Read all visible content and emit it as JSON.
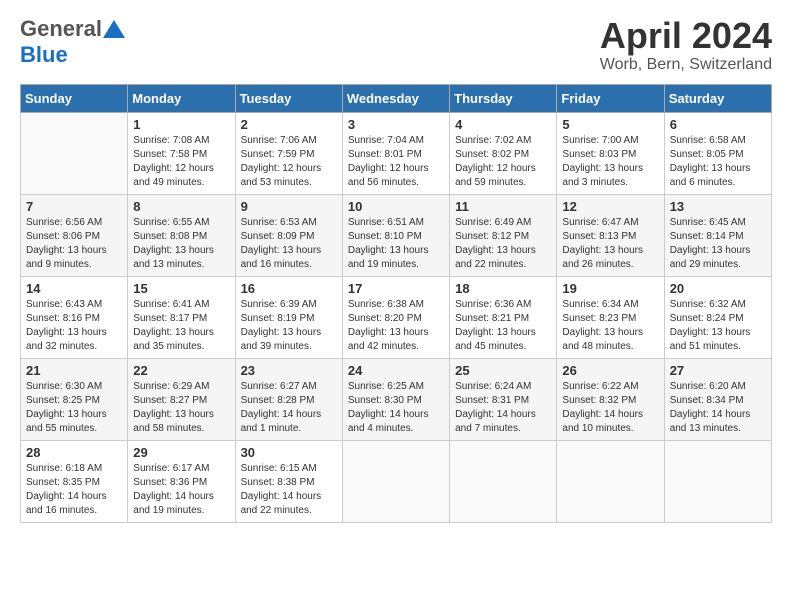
{
  "header": {
    "logo_general": "General",
    "logo_blue": "Blue",
    "month_title": "April 2024",
    "location": "Worb, Bern, Switzerland"
  },
  "days_of_week": [
    "Sunday",
    "Monday",
    "Tuesday",
    "Wednesday",
    "Thursday",
    "Friday",
    "Saturday"
  ],
  "weeks": [
    [
      {
        "day": "",
        "info": ""
      },
      {
        "day": "1",
        "info": "Sunrise: 7:08 AM\nSunset: 7:58 PM\nDaylight: 12 hours\nand 49 minutes."
      },
      {
        "day": "2",
        "info": "Sunrise: 7:06 AM\nSunset: 7:59 PM\nDaylight: 12 hours\nand 53 minutes."
      },
      {
        "day": "3",
        "info": "Sunrise: 7:04 AM\nSunset: 8:01 PM\nDaylight: 12 hours\nand 56 minutes."
      },
      {
        "day": "4",
        "info": "Sunrise: 7:02 AM\nSunset: 8:02 PM\nDaylight: 12 hours\nand 59 minutes."
      },
      {
        "day": "5",
        "info": "Sunrise: 7:00 AM\nSunset: 8:03 PM\nDaylight: 13 hours\nand 3 minutes."
      },
      {
        "day": "6",
        "info": "Sunrise: 6:58 AM\nSunset: 8:05 PM\nDaylight: 13 hours\nand 6 minutes."
      }
    ],
    [
      {
        "day": "7",
        "info": "Sunrise: 6:56 AM\nSunset: 8:06 PM\nDaylight: 13 hours\nand 9 minutes."
      },
      {
        "day": "8",
        "info": "Sunrise: 6:55 AM\nSunset: 8:08 PM\nDaylight: 13 hours\nand 13 minutes."
      },
      {
        "day": "9",
        "info": "Sunrise: 6:53 AM\nSunset: 8:09 PM\nDaylight: 13 hours\nand 16 minutes."
      },
      {
        "day": "10",
        "info": "Sunrise: 6:51 AM\nSunset: 8:10 PM\nDaylight: 13 hours\nand 19 minutes."
      },
      {
        "day": "11",
        "info": "Sunrise: 6:49 AM\nSunset: 8:12 PM\nDaylight: 13 hours\nand 22 minutes."
      },
      {
        "day": "12",
        "info": "Sunrise: 6:47 AM\nSunset: 8:13 PM\nDaylight: 13 hours\nand 26 minutes."
      },
      {
        "day": "13",
        "info": "Sunrise: 6:45 AM\nSunset: 8:14 PM\nDaylight: 13 hours\nand 29 minutes."
      }
    ],
    [
      {
        "day": "14",
        "info": "Sunrise: 6:43 AM\nSunset: 8:16 PM\nDaylight: 13 hours\nand 32 minutes."
      },
      {
        "day": "15",
        "info": "Sunrise: 6:41 AM\nSunset: 8:17 PM\nDaylight: 13 hours\nand 35 minutes."
      },
      {
        "day": "16",
        "info": "Sunrise: 6:39 AM\nSunset: 8:19 PM\nDaylight: 13 hours\nand 39 minutes."
      },
      {
        "day": "17",
        "info": "Sunrise: 6:38 AM\nSunset: 8:20 PM\nDaylight: 13 hours\nand 42 minutes."
      },
      {
        "day": "18",
        "info": "Sunrise: 6:36 AM\nSunset: 8:21 PM\nDaylight: 13 hours\nand 45 minutes."
      },
      {
        "day": "19",
        "info": "Sunrise: 6:34 AM\nSunset: 8:23 PM\nDaylight: 13 hours\nand 48 minutes."
      },
      {
        "day": "20",
        "info": "Sunrise: 6:32 AM\nSunset: 8:24 PM\nDaylight: 13 hours\nand 51 minutes."
      }
    ],
    [
      {
        "day": "21",
        "info": "Sunrise: 6:30 AM\nSunset: 8:25 PM\nDaylight: 13 hours\nand 55 minutes."
      },
      {
        "day": "22",
        "info": "Sunrise: 6:29 AM\nSunset: 8:27 PM\nDaylight: 13 hours\nand 58 minutes."
      },
      {
        "day": "23",
        "info": "Sunrise: 6:27 AM\nSunset: 8:28 PM\nDaylight: 14 hours\nand 1 minute."
      },
      {
        "day": "24",
        "info": "Sunrise: 6:25 AM\nSunset: 8:30 PM\nDaylight: 14 hours\nand 4 minutes."
      },
      {
        "day": "25",
        "info": "Sunrise: 6:24 AM\nSunset: 8:31 PM\nDaylight: 14 hours\nand 7 minutes."
      },
      {
        "day": "26",
        "info": "Sunrise: 6:22 AM\nSunset: 8:32 PM\nDaylight: 14 hours\nand 10 minutes."
      },
      {
        "day": "27",
        "info": "Sunrise: 6:20 AM\nSunset: 8:34 PM\nDaylight: 14 hours\nand 13 minutes."
      }
    ],
    [
      {
        "day": "28",
        "info": "Sunrise: 6:18 AM\nSunset: 8:35 PM\nDaylight: 14 hours\nand 16 minutes."
      },
      {
        "day": "29",
        "info": "Sunrise: 6:17 AM\nSunset: 8:36 PM\nDaylight: 14 hours\nand 19 minutes."
      },
      {
        "day": "30",
        "info": "Sunrise: 6:15 AM\nSunset: 8:38 PM\nDaylight: 14 hours\nand 22 minutes."
      },
      {
        "day": "",
        "info": ""
      },
      {
        "day": "",
        "info": ""
      },
      {
        "day": "",
        "info": ""
      },
      {
        "day": "",
        "info": ""
      }
    ]
  ]
}
